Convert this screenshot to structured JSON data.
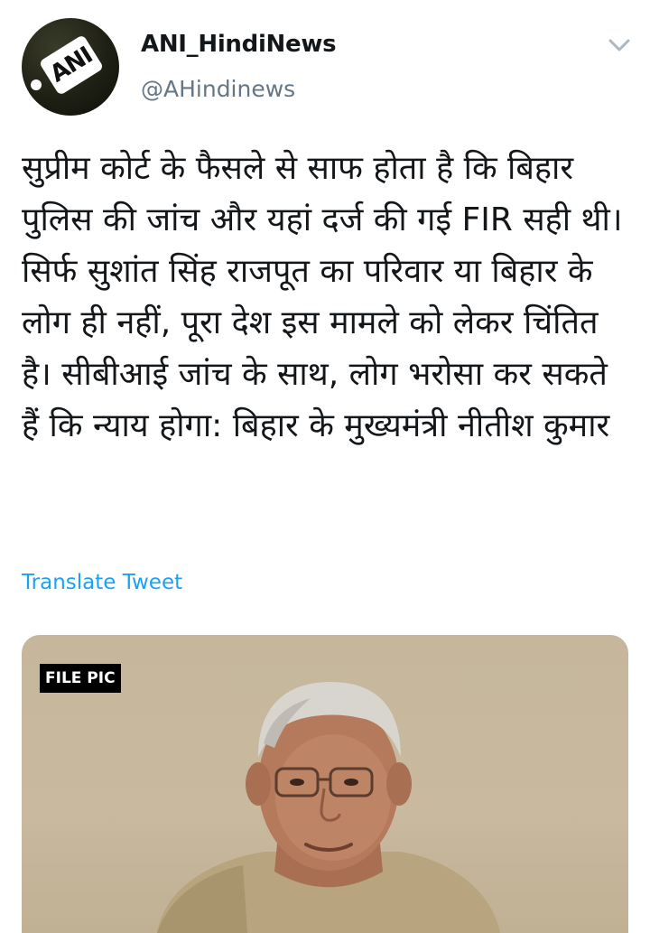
{
  "account": {
    "display_name": "ANI_HindiNews",
    "handle": "@AHindinews",
    "avatar_logo": "ANI"
  },
  "tweet": {
    "text": "सुप्रीम कोर्ट के फैसले से साफ होता है कि बिहार पुलिस की जांच और यहां दर्ज की गई FIR सही थी। सिर्फ सुशांत सिंह राजपूत का परिवार या बिहार के लोग ही नहीं, पूरा देश इस मामले को लेकर चिंतित है। सीबीआई जांच के साथ, लोग भरोसा कर सकते हैं कि न्याय होगा: बिहार के मुख्यमंत्री नीतीश कुमार",
    "translate_label": "Translate Tweet"
  },
  "media": {
    "badge": "FILE PIC"
  },
  "icons": {
    "menu": "chevron-down-icon"
  },
  "colors": {
    "link": "#1da1f2",
    "secondary_text": "#657786",
    "primary_text": "#14171a"
  }
}
